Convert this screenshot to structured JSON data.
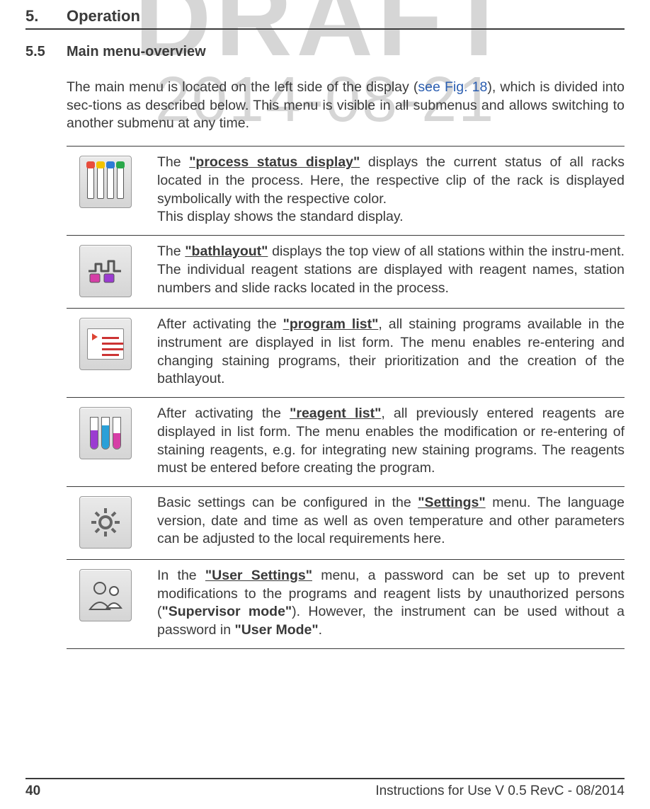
{
  "watermark": {
    "draft": "DRAFT",
    "date": "2014-08-21"
  },
  "chapter": {
    "num": "5.",
    "title": "Operation"
  },
  "section": {
    "num": "5.5",
    "title": "Main menu-overview"
  },
  "intro": {
    "pre": "The main menu is located on the left side of the display (",
    "link": "see Fig. 18",
    "post": "), which is divided into sec-tions as described below. This menu is visible in all submenus and allows switching to another submenu at any time."
  },
  "rows": [
    {
      "parts": [
        {
          "t": "The "
        },
        {
          "t": "\"process status display\"",
          "b": true,
          "u": true
        },
        {
          "t": " displays the current status of all racks located in the process. Here, the respective clip of the rack is displayed symbolically with the respective color."
        }
      ],
      "extra": "This display shows the standard display."
    },
    {
      "parts": [
        {
          "t": "The "
        },
        {
          "t": "\"bathlayout\"",
          "b": true,
          "u": true
        },
        {
          "t": " displays the top view of all stations within the instru-ment. The individual reagent stations are displayed with reagent names, station numbers and slide racks located in the process."
        }
      ]
    },
    {
      "parts": [
        {
          "t": "After activating the "
        },
        {
          "t": "\"program list\"",
          "b": true,
          "u": true
        },
        {
          "t": ", all staining programs available in the instrument are displayed in list form. The menu enables re-entering and changing staining programs, their prioritization and the creation of the bathlayout."
        }
      ]
    },
    {
      "parts": [
        {
          "t": "After activating the "
        },
        {
          "t": "\"reagent list\"",
          "b": true,
          "u": true
        },
        {
          "t": ", all previously entered reagents are displayed in list form. The menu enables the modification or re-entering of staining reagents, e.g. for integrating new staining programs. The reagents must be entered before creating the program."
        }
      ]
    },
    {
      "parts": [
        {
          "t": "Basic settings can be configured in the "
        },
        {
          "t": "\"Settings\"",
          "b": true,
          "u": true
        },
        {
          "t": " menu. The language version, date and time as well as oven temperature and other parameters can be adjusted to the local requirements here."
        }
      ]
    },
    {
      "parts": [
        {
          "t": "In the "
        },
        {
          "t": "\"User Settings\"",
          "b": true,
          "u": true
        },
        {
          "t": " menu, a password can be set up to prevent modifications to the programs and reagent lists by unauthorized persons ("
        },
        {
          "t": "\"Supervisor mode\"",
          "b": true
        },
        {
          "t": "). However, the instrument can be used without a password in "
        },
        {
          "t": "\"User Mode\"",
          "b": true
        },
        {
          "t": "."
        }
      ]
    }
  ],
  "footer": {
    "page": "40",
    "doc": "Instructions for Use V 0.5 RevC - 08/2014"
  }
}
